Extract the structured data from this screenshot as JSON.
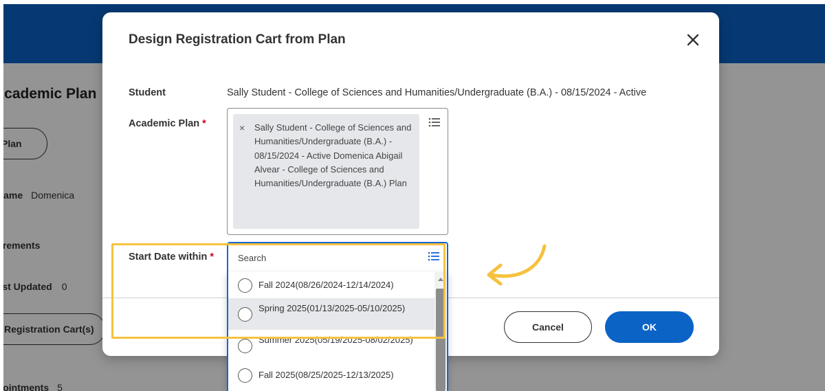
{
  "background": {
    "page_title": "Academic Plan",
    "plan_button_label": "Plan",
    "name_label": "Name",
    "name_value": "Domenica",
    "requirements_label": "Academic Requirements",
    "last_updated_label": "Last Updated",
    "last_updated_value": "0",
    "registration_cart_button_label": "Registration Cart(s)",
    "appointments_label": "Appointments",
    "appointments_value": "5"
  },
  "dialog": {
    "title": "Design Registration Cart from Plan",
    "student_label": "Student",
    "student_value": "Sally Student - College of Sciences and Humanities/Undergraduate (B.A.) - 08/15/2024 - Active",
    "academic_plan_label": "Academic Plan",
    "academic_plan_value": "Sally Student - College of Sciences and Humanities/Undergraduate (B.A.) - 08/15/2024 - Active Domenica Abigail Alvear - College of Sciences and Humanities/Undergraduate (B.A.) Plan",
    "start_date_label": "Start Date within",
    "required_marker": "*",
    "search_placeholder": "Search",
    "cancel_label": "Cancel",
    "ok_label": "OK",
    "close_glyph": "✕",
    "chip_remove_glyph": "×"
  },
  "dropdown": {
    "options": [
      {
        "label": "Fall 2024(08/26/2024-12/14/2024)",
        "selected": false
      },
      {
        "label": "Spring 2025(01/13/2025-05/10/2025)",
        "selected": false
      },
      {
        "label": "Summer 2025(05/19/2025-08/02/2025)",
        "selected": false
      },
      {
        "label": "Fall 2025(08/25/2025-12/13/2025)",
        "selected": false
      }
    ]
  },
  "colors": {
    "brand_blue": "#0b63c6",
    "focus_blue": "#1566d8",
    "highlight_yellow": "#f6c23e",
    "required_red": "#d0021b"
  },
  "icons": {
    "close": "close-icon",
    "prompt": "prompt-list-icon",
    "remove": "remove-x-icon",
    "annotation": "curved-arrow-icon"
  }
}
